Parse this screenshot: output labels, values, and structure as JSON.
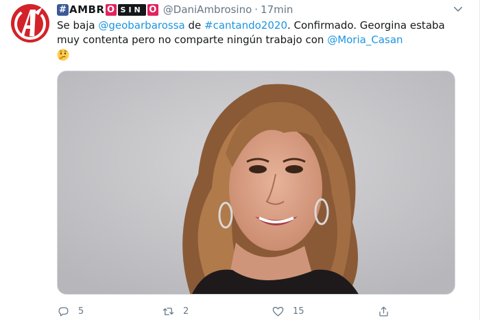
{
  "tweet": {
    "display_name_left": "AMBR",
    "display_name_red1": "O",
    "display_name_black": "SIN",
    "display_name_red2": "O",
    "hash_symbol": "#",
    "handle": "@DaniAmbrosino",
    "separator": "·",
    "time": "17min",
    "text_1": "Se baja ",
    "mention_1": "@geobarbarossa",
    "text_2": " de ",
    "hashtag_1": "#cantando2020",
    "text_3": ". Confirmado. Georgina estaba muy contenta pero no comparte ningún trabajo con ",
    "mention_2": "@Moria_Casan",
    "emoji": "thinking-face-emoji"
  },
  "actions": {
    "reply_count": "5",
    "retweet_count": "2",
    "like_count": "15"
  },
  "colors": {
    "link": "#1b95e0",
    "muted": "#657786",
    "avatar_red": "#d3222a"
  }
}
